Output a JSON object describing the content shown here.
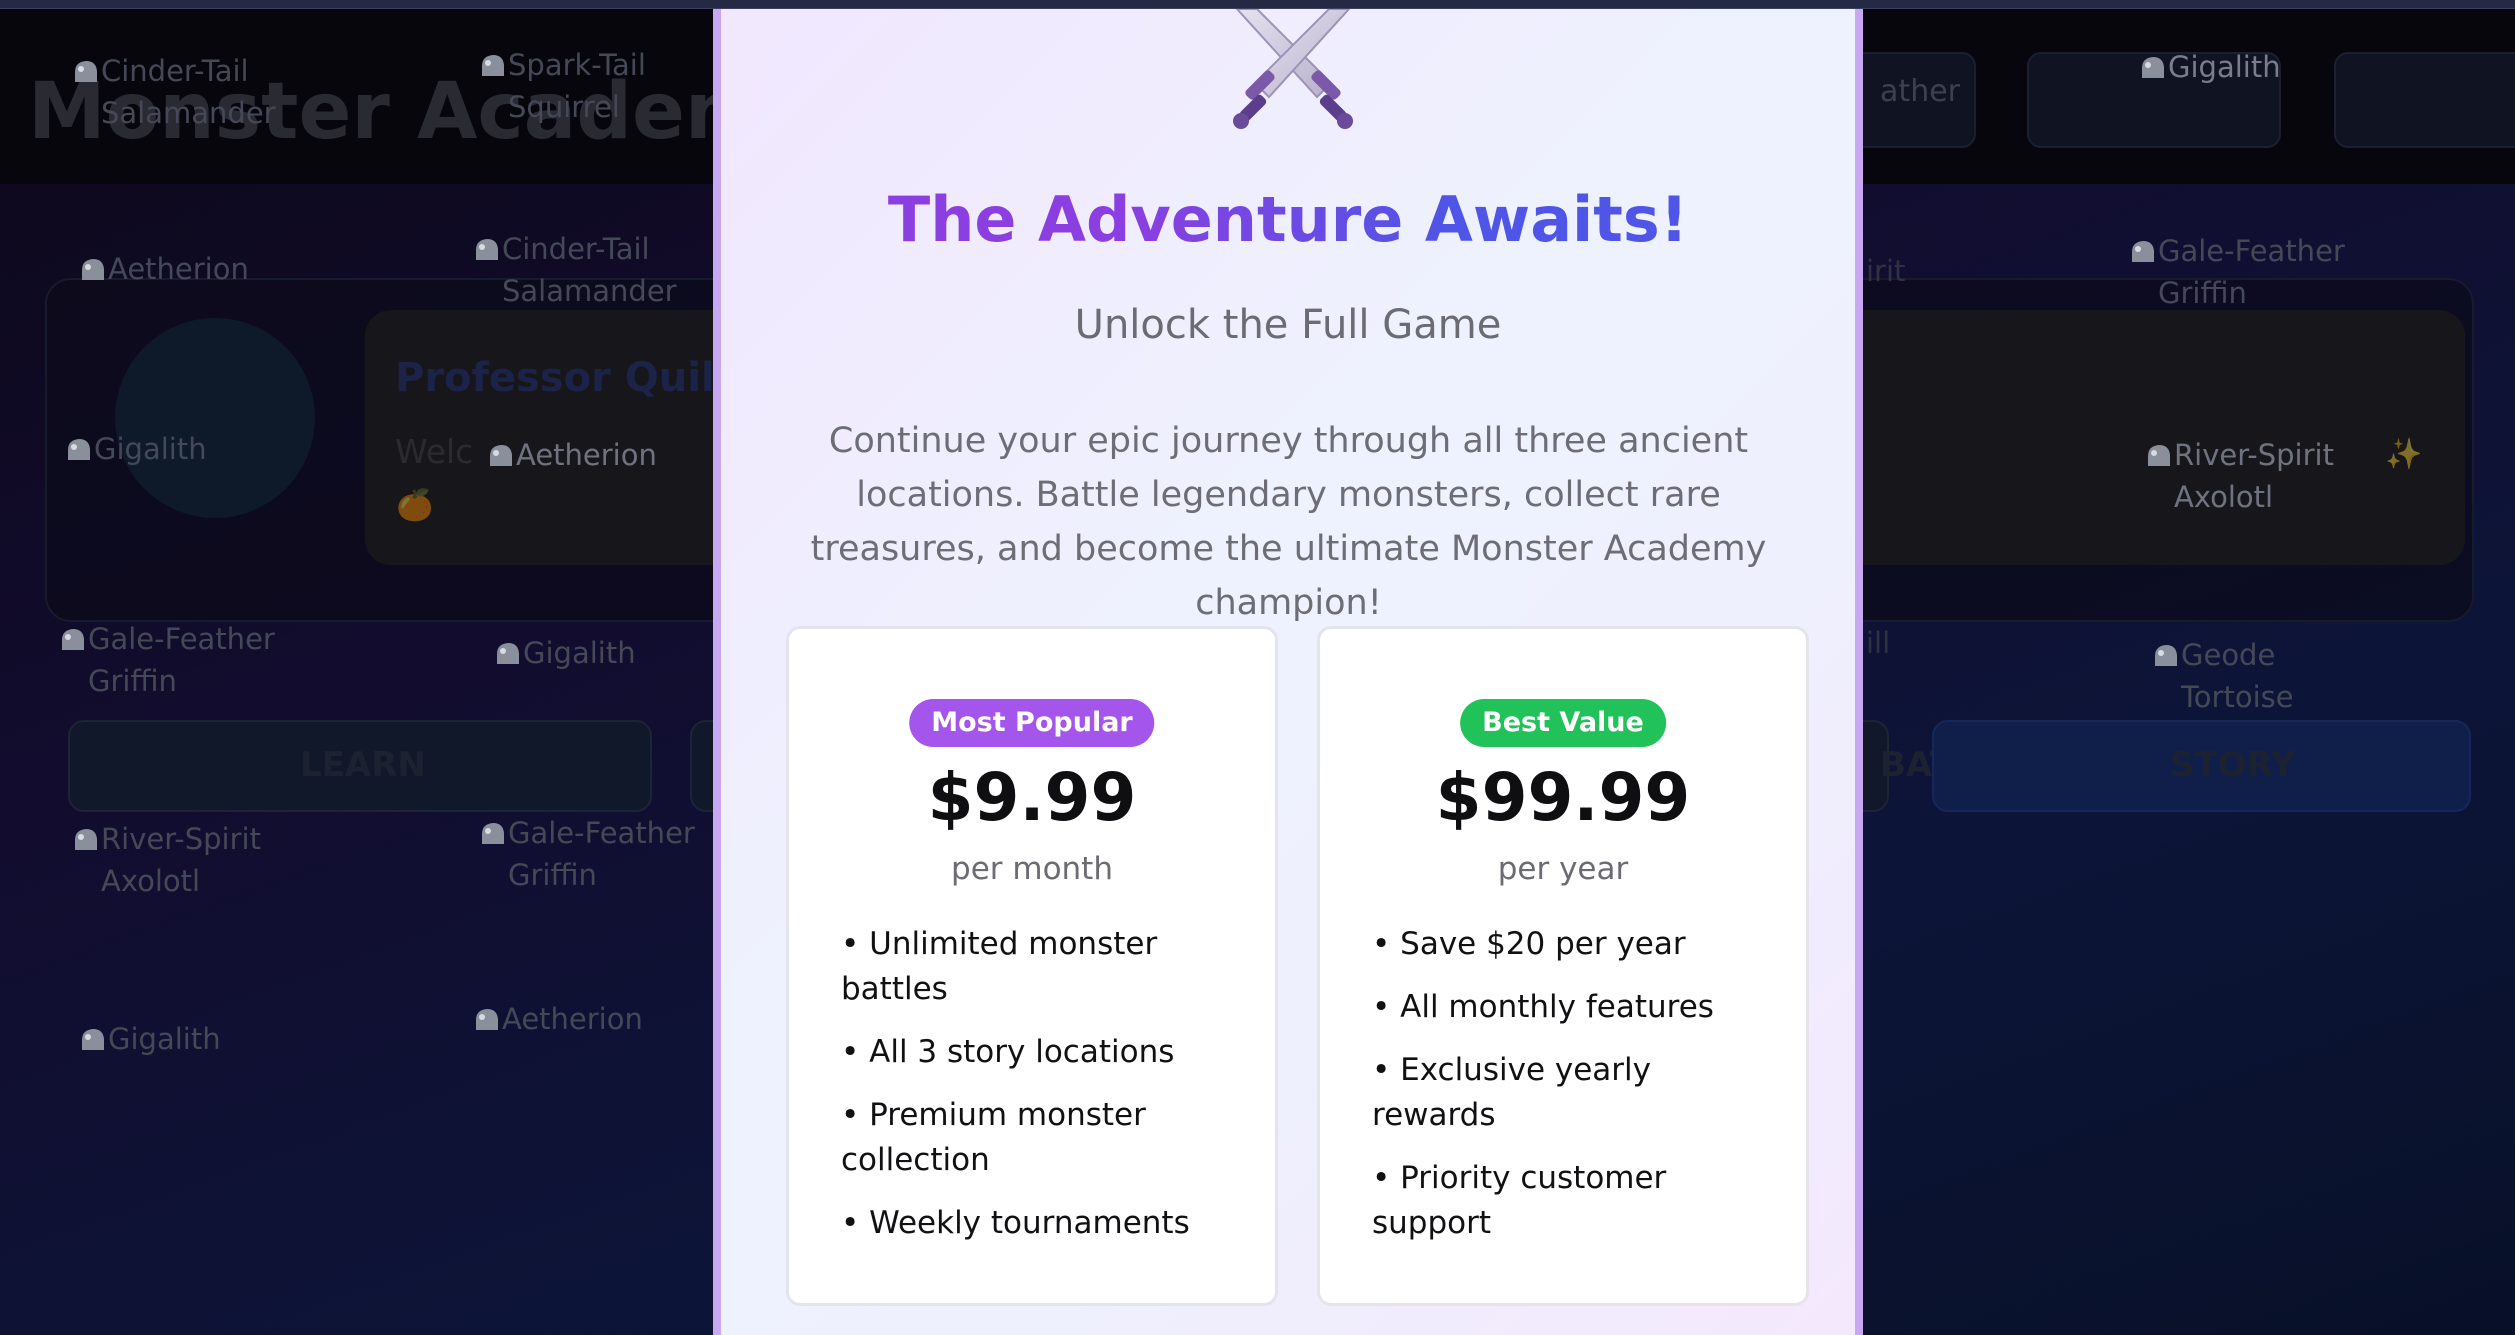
{
  "background": {
    "app_title": "Monster Academy",
    "professor_name": "Professor Quill",
    "nav_partial_label": "ather",
    "dialogue_partial": "Welc",
    "dialogue_emoji": "🍊",
    "dialogue_end_emoji": "✨",
    "buttons": [
      {
        "label": "LEARN"
      },
      {
        "label": "BATTLE"
      },
      {
        "label": "STORY"
      }
    ],
    "broken_images": [
      {
        "alt": "Cinder-Tail Salamander"
      },
      {
        "alt": "Spark-Tail Squirrel"
      },
      {
        "alt": "Gigalith"
      },
      {
        "alt": "Aetherion"
      },
      {
        "alt": "Cinder-Tail Salamander"
      },
      {
        "alt": "Gale-Feather Griffin"
      },
      {
        "alt": "Gigalith"
      },
      {
        "alt": "Aetherion"
      },
      {
        "alt": "River-Spirit Axolotl"
      },
      {
        "alt": "Gale-Feather Griffin"
      },
      {
        "alt": "Gigalith"
      },
      {
        "alt": "Geode Tortoise"
      },
      {
        "alt": "River-Spirit Axolotl"
      },
      {
        "alt": "Gale-Feather Griffin"
      },
      {
        "alt": "Gigalith"
      },
      {
        "alt": "Aetherion"
      },
      {
        "alt": "irit"
      },
      {
        "alt": "ill"
      }
    ]
  },
  "modal": {
    "icon": "crossed-swords-icon",
    "title": "The Adventure Awaits!",
    "subtitle": "Unlock the Full Game",
    "description": "Continue your epic journey through all three ancient locations. Battle legendary monsters, collect rare treasures, and become the ultimate Monster Academy champion!",
    "title_gradient": [
      "#8b3fe0",
      "#4f55e6"
    ],
    "plans": [
      {
        "badge": "Most Popular",
        "badge_color": "#a455ec",
        "price": "$9.99",
        "period": "per month",
        "features": [
          "Unlimited monster battles",
          "All 3 story locations",
          "Premium monster collection",
          "Weekly tournaments"
        ]
      },
      {
        "badge": "Best Value",
        "badge_color": "#22c25a",
        "price": "$99.99",
        "period": "per year",
        "features": [
          "Save $20 per year",
          "All monthly features",
          "Exclusive yearly rewards",
          "Priority customer support"
        ]
      }
    ]
  }
}
